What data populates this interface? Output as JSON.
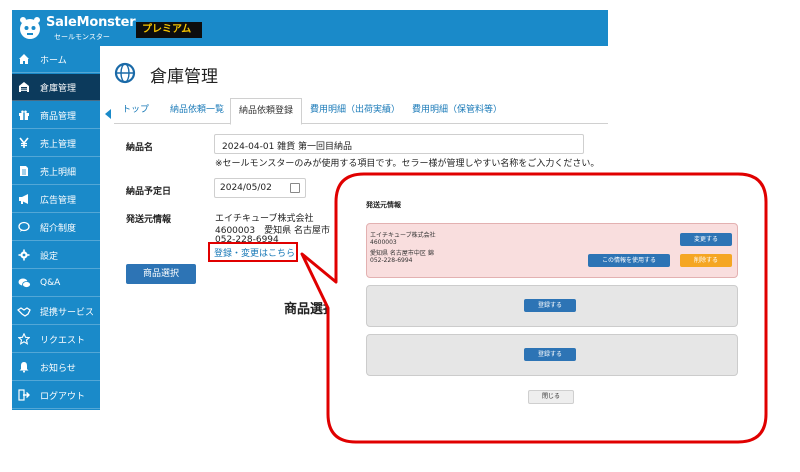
{
  "header": {
    "brand_name": "SaleMonster",
    "brand_sub": "セールモンスター",
    "premium": "プレミアム"
  },
  "sidebar": {
    "items": [
      {
        "label": "ホーム",
        "icon": "home-icon"
      },
      {
        "label": "倉庫管理",
        "icon": "warehouse-icon"
      },
      {
        "label": "商品管理",
        "icon": "gift-icon"
      },
      {
        "label": "売上管理",
        "icon": "yen-icon"
      },
      {
        "label": "売上明細",
        "icon": "document-icon"
      },
      {
        "label": "広告管理",
        "icon": "megaphone-icon"
      },
      {
        "label": "紹介制度",
        "icon": "chat-icon"
      },
      {
        "label": "設定",
        "icon": "gear-icon"
      },
      {
        "label": "Q&A",
        "icon": "comments-icon"
      },
      {
        "label": "提携サービス",
        "icon": "handshake-icon"
      },
      {
        "label": "リクエスト",
        "icon": "star-icon"
      },
      {
        "label": "お知らせ",
        "icon": "bell-icon"
      },
      {
        "label": "ログアウト",
        "icon": "logout-icon"
      }
    ],
    "active_index": 1
  },
  "page": {
    "title": "倉庫管理"
  },
  "tabs": [
    {
      "label": "トップ"
    },
    {
      "label": "納品依頼一覧"
    },
    {
      "label": "納品依頼登録"
    },
    {
      "label": "費用明細（出荷実績）"
    },
    {
      "label": "費用明細（保管料等）"
    }
  ],
  "form": {
    "name_label": "納品名",
    "name_value": "2024-04-01 雑貨 第一回目納品",
    "name_note": "※セールモンスターのみが使用する項目です。セラー様が管理しやすい名称をご入力ください。",
    "date_label": "納品予定日",
    "date_value": "2024/05/02",
    "sender_label": "発送元情報",
    "sender_company": "エイチキューブ株式会社",
    "sender_address": "4600003　愛知県 名古屋市",
    "sender_phone": "052-228-6994",
    "sender_link": "登録・変更はこちら",
    "select_button": "商品選択",
    "big_heading": "商品選択"
  },
  "modal": {
    "title": "発送元情報",
    "card": {
      "company": "エイチキューブ株式会社",
      "postal": "4600003",
      "address": "愛知県 名古屋市中区 錦",
      "phone": "052-228-6994",
      "edit_button": "変更する",
      "use_button": "この情報を使用する",
      "delete_button": "削除する"
    },
    "register_button_1": "登録する",
    "register_button_2": "登録する",
    "close_button": "閉じる"
  },
  "colors": {
    "brand_blue": "#1a8ac9",
    "active_nav": "#0c3a5c",
    "button_blue": "#2d74b5",
    "callout_red": "#e00000",
    "orange": "#f5a623"
  }
}
